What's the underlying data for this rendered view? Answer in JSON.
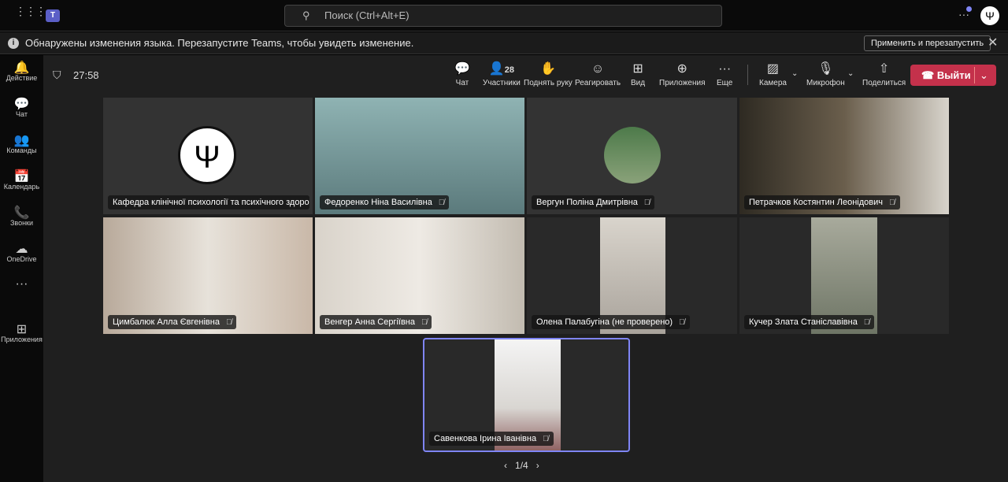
{
  "topbar": {
    "search_placeholder": "Поиск (Ctrl+Alt+E)",
    "avatar_text": "Ψ"
  },
  "banner": {
    "message": "Обнаружены изменения языка. Перезапустите Teams, чтобы увидеть изменение.",
    "apply_label": "Применить и перезапустить"
  },
  "rail": {
    "items": [
      {
        "label": "Действие",
        "icon": "bell-icon",
        "glyph": "🔔"
      },
      {
        "label": "Чат",
        "icon": "chat-icon",
        "glyph": "💬"
      },
      {
        "label": "Команды",
        "icon": "teams-icon",
        "glyph": "👥"
      },
      {
        "label": "Календарь",
        "icon": "calendar-icon",
        "glyph": "📅"
      },
      {
        "label": "Звонки",
        "icon": "phone-icon",
        "glyph": "📞"
      },
      {
        "label": "OneDrive",
        "icon": "cloud-icon",
        "glyph": "☁"
      },
      {
        "label": "",
        "icon": "more-icon",
        "glyph": "···"
      },
      {
        "label": "Приложения",
        "icon": "add-apps-icon",
        "glyph": "⊞"
      }
    ]
  },
  "meeting": {
    "timer": "27:58",
    "participants_count": "28",
    "toolbar": {
      "chat": "Чат",
      "participants": "Участники",
      "raise_hand": "Поднять руку",
      "react": "Реагировать",
      "view": "Вид",
      "apps": "Приложения",
      "more": "Еще",
      "camera": "Камера",
      "mic": "Микрофон",
      "share": "Поделиться",
      "leave": "Выйти"
    },
    "accent": "#c4314b"
  },
  "tiles": [
    {
      "name": "Кафедра клінічної психології та психічного здоров'я"
    },
    {
      "name": "Федоренко Ніна Василівна"
    },
    {
      "name": "Вергун Поліна Дмитрівна"
    },
    {
      "name": "Петрачков Костянтин Леонідович"
    },
    {
      "name": "Цимбалюк Алла Євгенівна"
    },
    {
      "name": "Венгер Анна Сергіївна"
    },
    {
      "name": "Олена Палабугіна (не проверено)"
    },
    {
      "name": "Кучер Злата Станіславівна"
    },
    {
      "name": "Савенкова Ірина Іванівна"
    }
  ],
  "pager": {
    "text": "1/4"
  }
}
